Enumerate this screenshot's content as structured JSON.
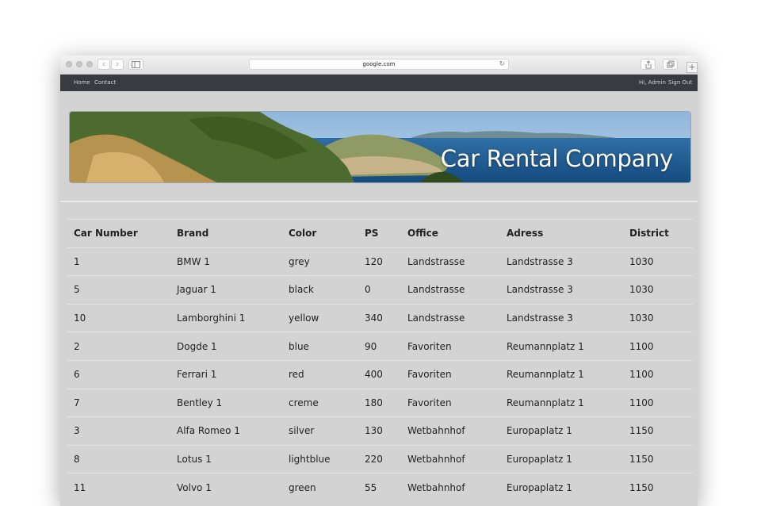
{
  "browser": {
    "address": "google.com",
    "back_glyph": "‹",
    "forward_glyph": "›",
    "new_tab_glyph": "+",
    "reload_glyph": "↻"
  },
  "nav": {
    "home": "Home",
    "contact": "Contact",
    "greeting": "Hi, Admin",
    "sign_out": "Sign Out"
  },
  "banner": {
    "title": "Car Rental Company"
  },
  "table": {
    "headers": [
      "Car Number",
      "Brand",
      "Color",
      "PS",
      "Office",
      "Adress",
      "District"
    ],
    "rows": [
      [
        "1",
        "BMW 1",
        "grey",
        "120",
        "Landstrasse",
        "Landstrasse 3",
        "1030"
      ],
      [
        "5",
        "Jaguar 1",
        "black",
        "0",
        "Landstrasse",
        "Landstrasse 3",
        "1030"
      ],
      [
        "10",
        "Lamborghini 1",
        "yellow",
        "340",
        "Landstrasse",
        "Landstrasse 3",
        "1030"
      ],
      [
        "2",
        "Dogde 1",
        "blue",
        "90",
        "Favoriten",
        "Reumannplatz 1",
        "1100"
      ],
      [
        "6",
        "Ferrari 1",
        "red",
        "400",
        "Favoriten",
        "Reumannplatz 1",
        "1100"
      ],
      [
        "7",
        "Bentley 1",
        "creme",
        "180",
        "Favoriten",
        "Reumannplatz 1",
        "1100"
      ],
      [
        "3",
        "Alfa Romeo 1",
        "silver",
        "130",
        "Wetbahnhof",
        "Europaplatz 1",
        "1150"
      ],
      [
        "8",
        "Lotus 1",
        "lightblue",
        "220",
        "Wetbahnhof",
        "Europaplatz 1",
        "1150"
      ],
      [
        "11",
        "Volvo 1",
        "green",
        "55",
        "Wetbahnhof",
        "Europaplatz 1",
        "1150"
      ]
    ]
  }
}
